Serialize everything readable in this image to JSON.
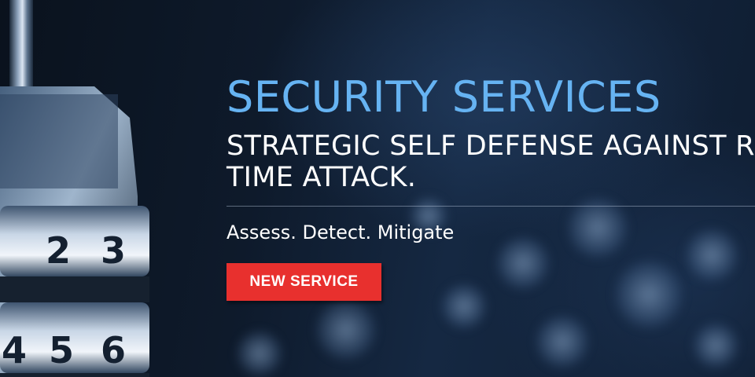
{
  "hero": {
    "title": "SECURITY SERVICES",
    "subtitle_line1": "STRATEGIC SELF DEFENSE AGAINST REAL",
    "subtitle_line2": "TIME ATTACK.",
    "tagline": "Assess. Detect. Mitigate",
    "cta_label": "NEW SERVICE"
  },
  "padlock": {
    "dial_top": [
      "2",
      "3"
    ],
    "dial_bottom": [
      "4",
      "5",
      "6"
    ]
  },
  "colors": {
    "title": "#66b3f2",
    "cta_background": "#e8302e",
    "background": "#0b1422"
  }
}
